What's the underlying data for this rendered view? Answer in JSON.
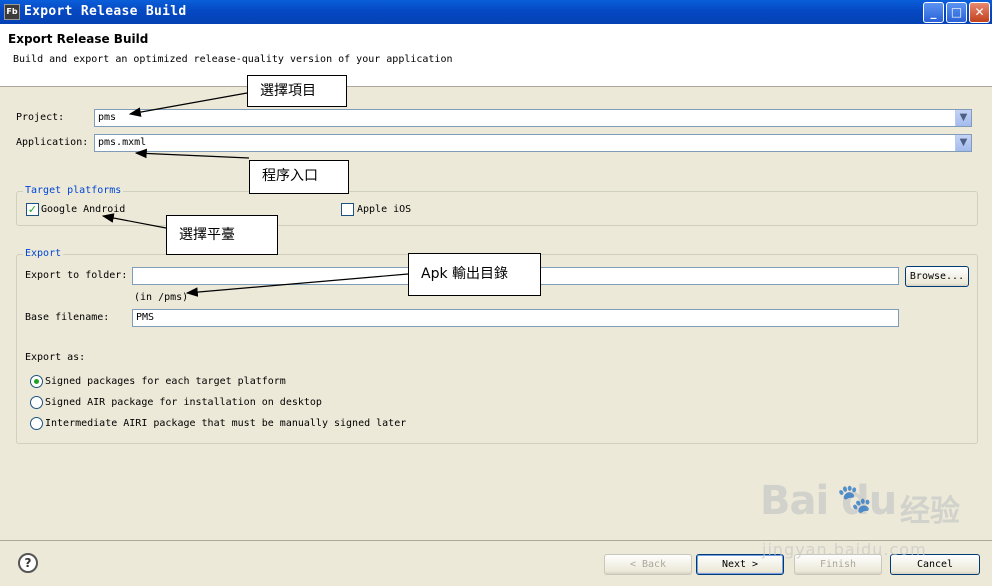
{
  "window": {
    "icon_text": "Fb",
    "title": "Export Release Build",
    "min_glyph": "_",
    "max_glyph": "□",
    "close_glyph": "✕"
  },
  "header": {
    "title": "Export Release Build",
    "description": "Build and export an optimized release-quality version of your application"
  },
  "project": {
    "label": "Project:",
    "value": "pms"
  },
  "application": {
    "label": "Application:",
    "value": "pms.mxml"
  },
  "target_platforms": {
    "title": "Target platforms",
    "items": [
      {
        "label": "Google Android",
        "checked": true
      },
      {
        "label": "Apple iOS",
        "checked": false
      }
    ]
  },
  "export": {
    "title": "Export",
    "folder_label": "Export to folder:",
    "folder_value": "",
    "folder_hint": "(in /pms)",
    "browse_label": "Browse...",
    "filename_label": "Base filename:",
    "filename_value": "PMS",
    "export_as_label": "Export as:",
    "options": [
      {
        "label": "Signed packages for each target platform",
        "selected": true
      },
      {
        "label": "Signed AIR package for installation on desktop",
        "selected": false
      },
      {
        "label": "Intermediate AIRI package that must be manually signed later",
        "selected": false
      }
    ]
  },
  "footer": {
    "help_glyph": "?",
    "back_label": "< Back",
    "next_label": "Next >",
    "finish_label": "Finish",
    "cancel_label": "Cancel"
  },
  "annotations": {
    "select_project": "選擇項目",
    "program_entry": "程序入口",
    "select_platform": "選擇平臺",
    "apk_output": "Apk 輸出目錄"
  },
  "watermark": {
    "brand": "Bai  du",
    "brand_cn": "经验",
    "url": "jingyan.baidu.com"
  }
}
